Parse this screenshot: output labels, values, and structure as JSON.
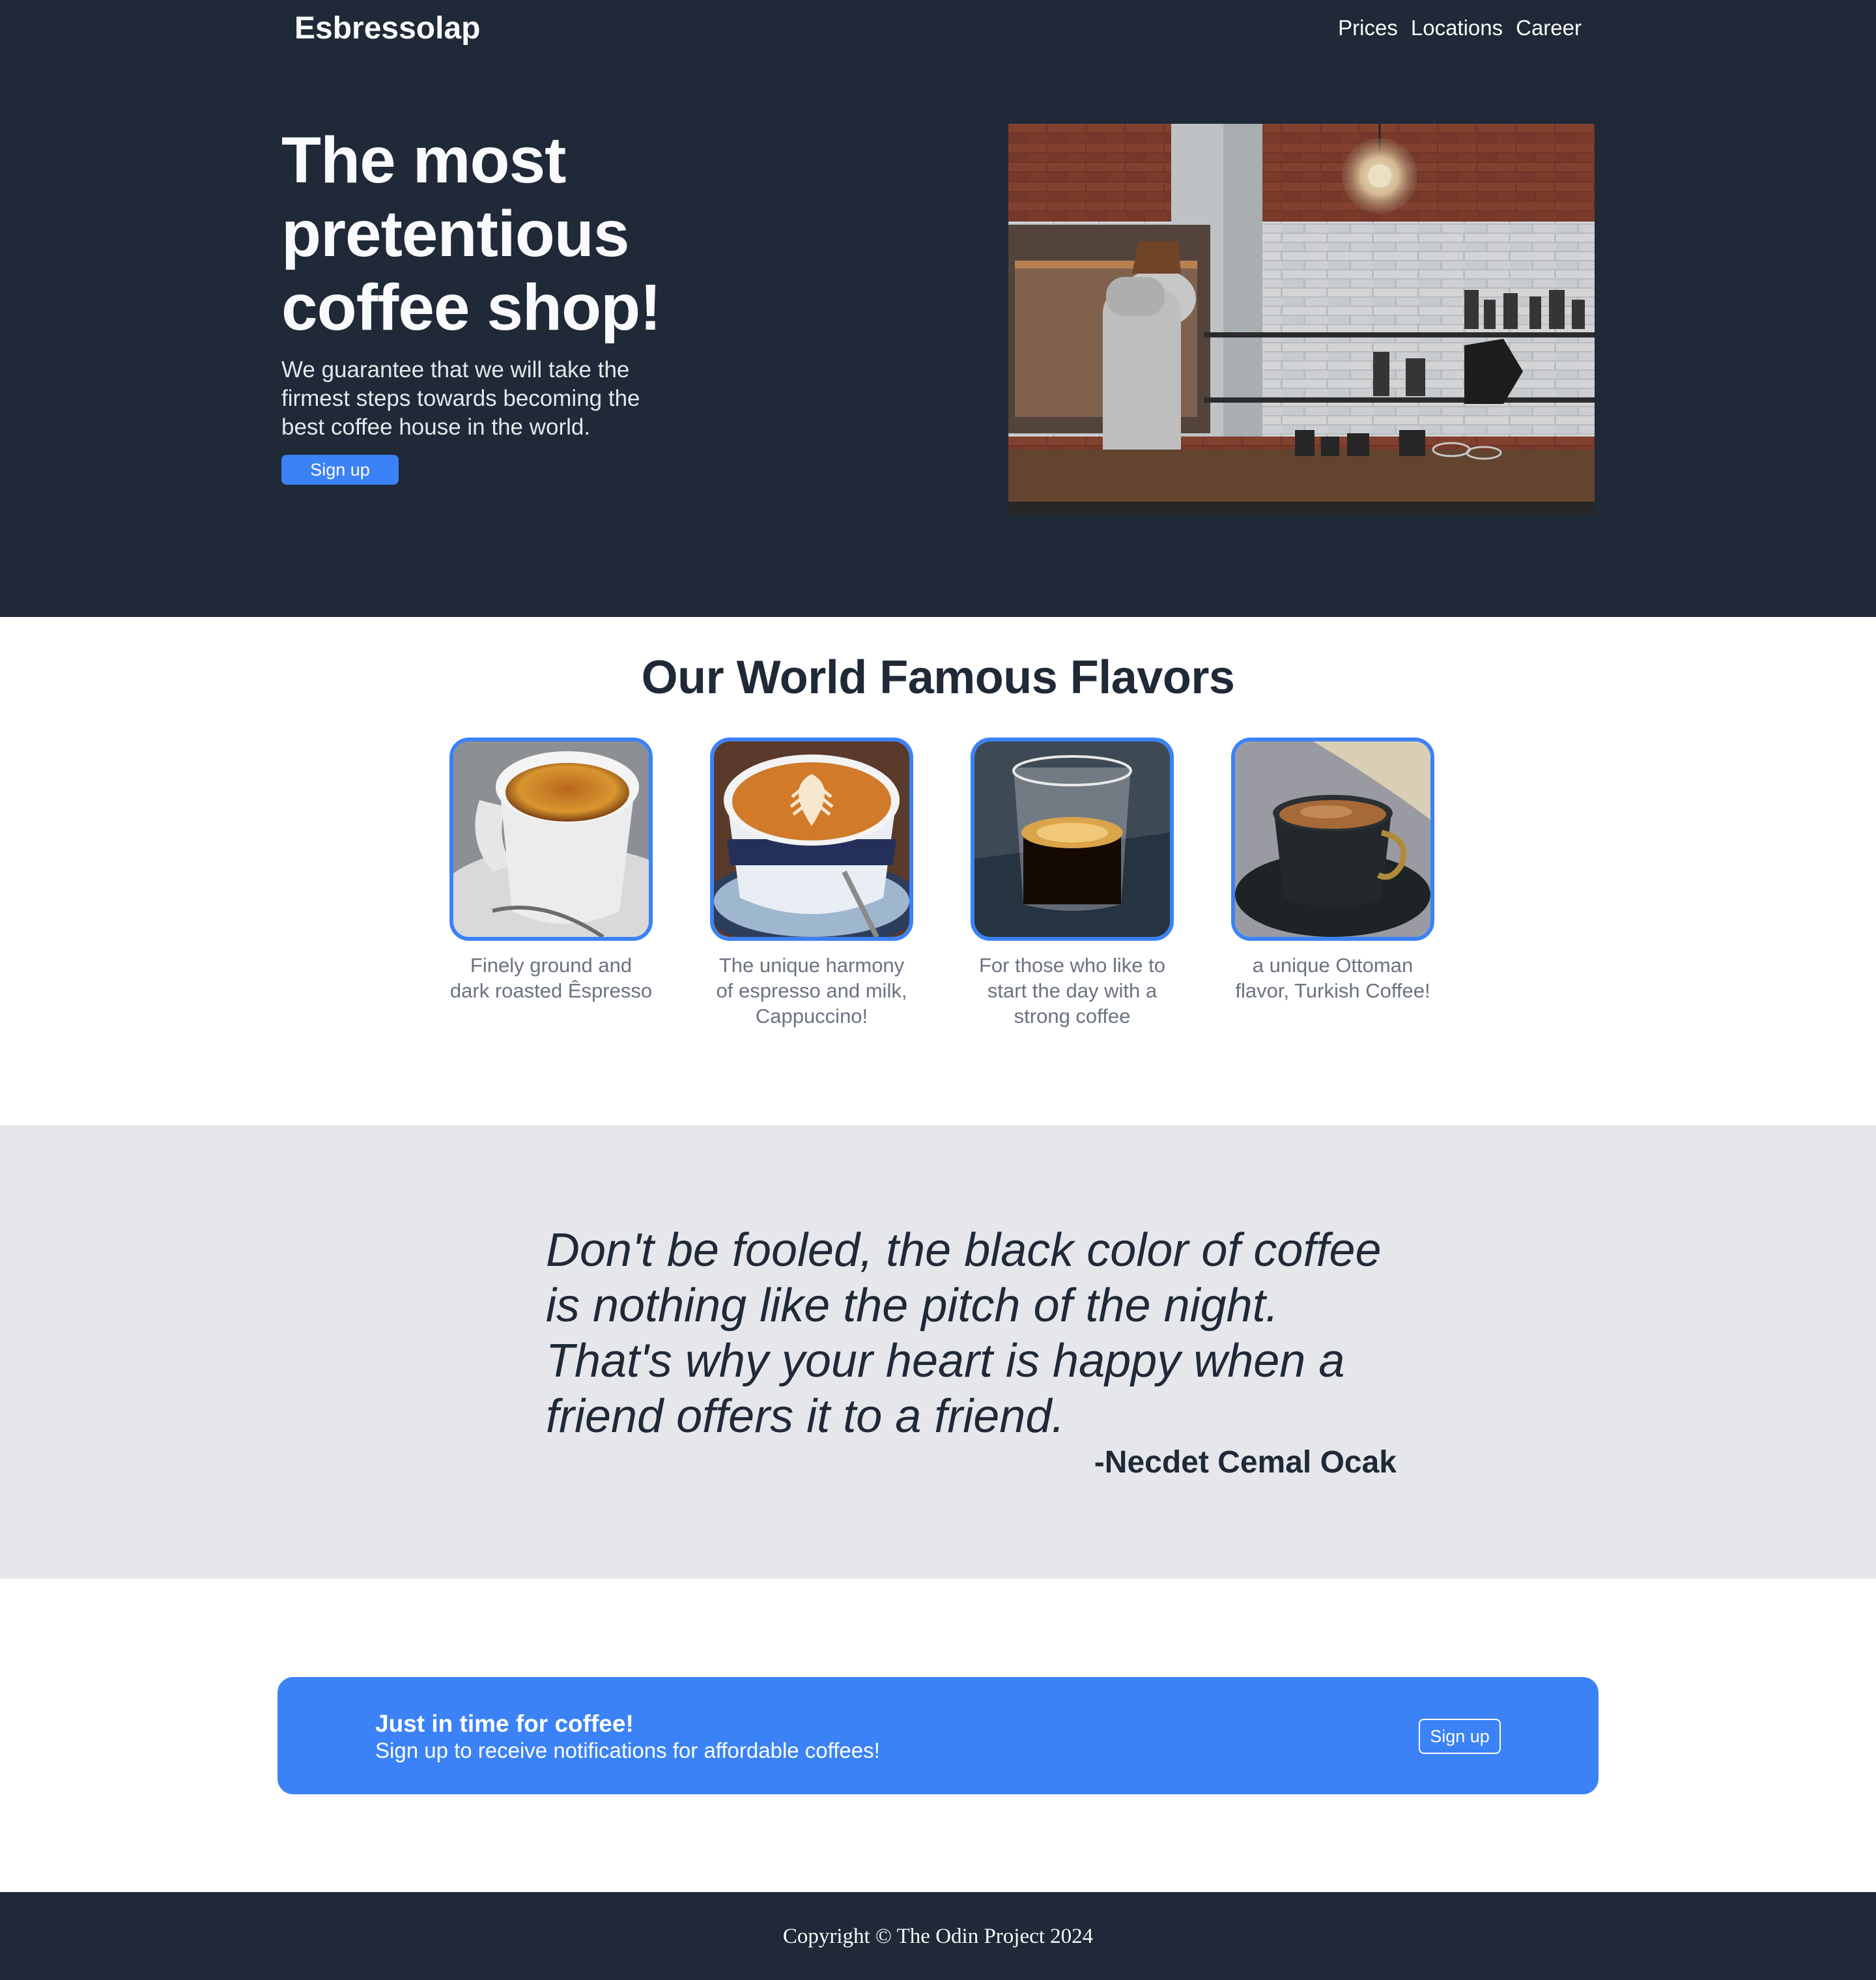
{
  "header": {
    "brand": "Esbressolap",
    "nav": [
      "Prices",
      "Locations",
      "Career"
    ]
  },
  "hero": {
    "title": "The most pretentious coffee shop!",
    "subtitle": "We guarantee that we will take the firmest steps towards becoming the best coffee house in the world.",
    "cta_label": "Sign up",
    "image": "coffee-shop-counter-photo"
  },
  "flavors": {
    "title": "Our World Famous Flavors",
    "items": [
      {
        "image": "espresso-cup-photo",
        "caption": "Finely ground and dark roasted Êspresso"
      },
      {
        "image": "cappuccino-latte-art-photo",
        "caption": "The unique harmony of espresso and milk, Cappuccino!"
      },
      {
        "image": "strong-coffee-glass-photo",
        "caption": "For those who like to start the day with a strong coffee"
      },
      {
        "image": "turkish-coffee-cup-photo",
        "caption": "a unique Ottoman flavor, Turkish Coffee!"
      }
    ]
  },
  "quote": {
    "text": "Don't be fooled, the black color of coffee is nothing like the pitch of the night. That's why your heart is happy when a friend offers it to a friend.",
    "author": "-Necdet Cemal Ocak"
  },
  "cta": {
    "title": "Just in time for coffee!",
    "subtitle": "Sign up to receive notifications for affordable coffees!",
    "button": "Sign up"
  },
  "footer": {
    "text": "Copyright © The Odin Project 2024"
  },
  "colors": {
    "dark": "#1f2937",
    "accent": "#3b82f6",
    "quote_bg": "#e5e7eb",
    "caption": "#6b7280"
  }
}
